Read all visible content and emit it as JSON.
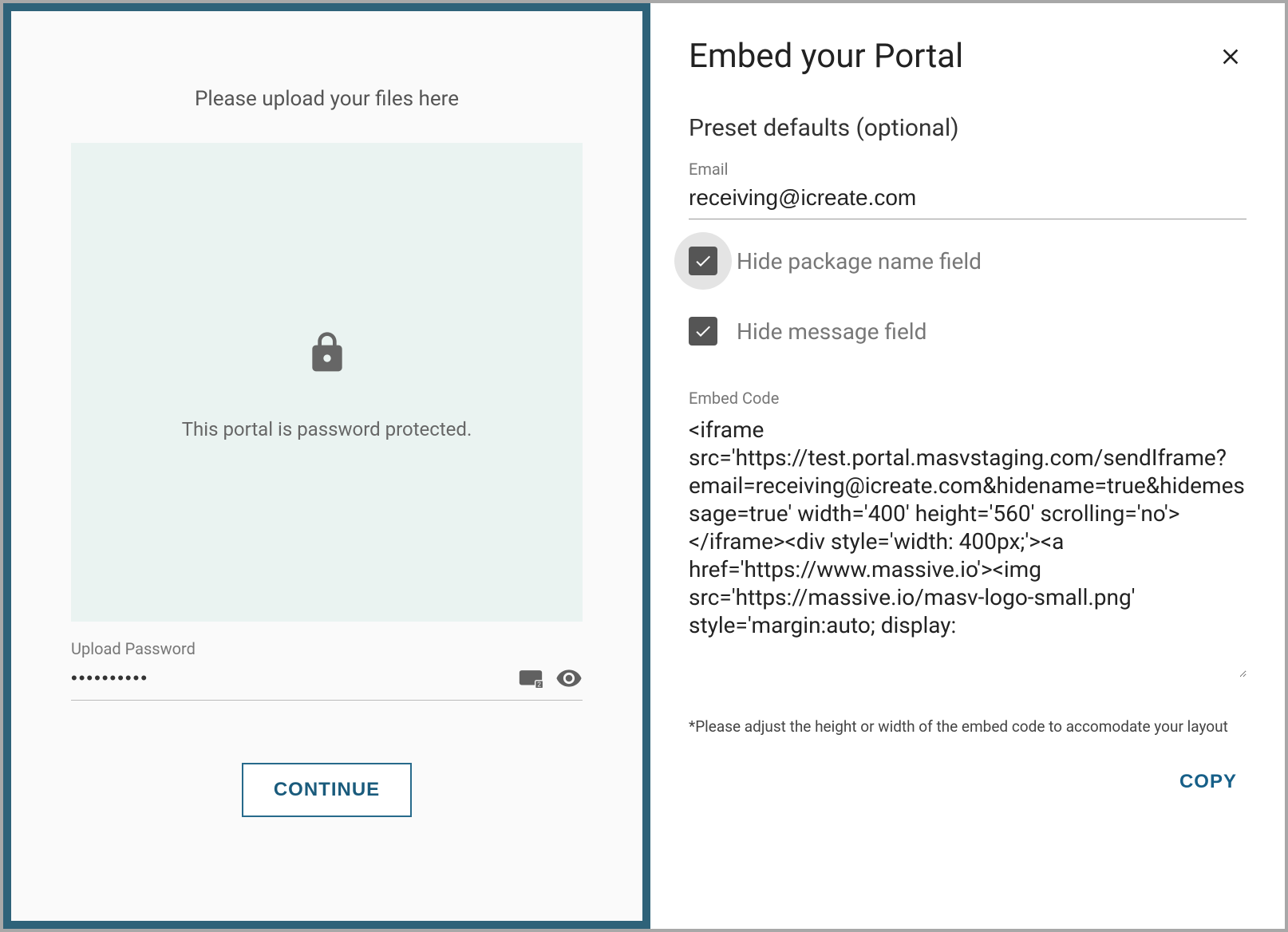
{
  "left": {
    "title": "Please upload your files here",
    "protected_text": "This portal is password protected.",
    "password_label": "Upload Password",
    "password_value": "••••••••••",
    "continue_label": "CONTINUE"
  },
  "right": {
    "title": "Embed your Portal",
    "preset_title": "Preset defaults (optional)",
    "email_label": "Email",
    "email_value": "receiving@icreate.com",
    "hide_name_label": "Hide package name field",
    "hide_name_checked": true,
    "hide_message_label": "Hide message field",
    "hide_message_checked": true,
    "embed_label": "Embed Code",
    "embed_code": "<iframe src='https://test.portal.masvstaging.com/sendIframe?email=receiving@icreate.com&hidename=true&hidemessage=true' width='400' height='560' scrolling='no'></iframe><div style='width: 400px;'><a href='https://www.massive.io'><img src='https://massive.io/masv-logo-small.png' style='margin:auto; display:",
    "note": "*Please adjust the height or width of the embed code to accomodate your layout",
    "copy_label": "COPY"
  }
}
